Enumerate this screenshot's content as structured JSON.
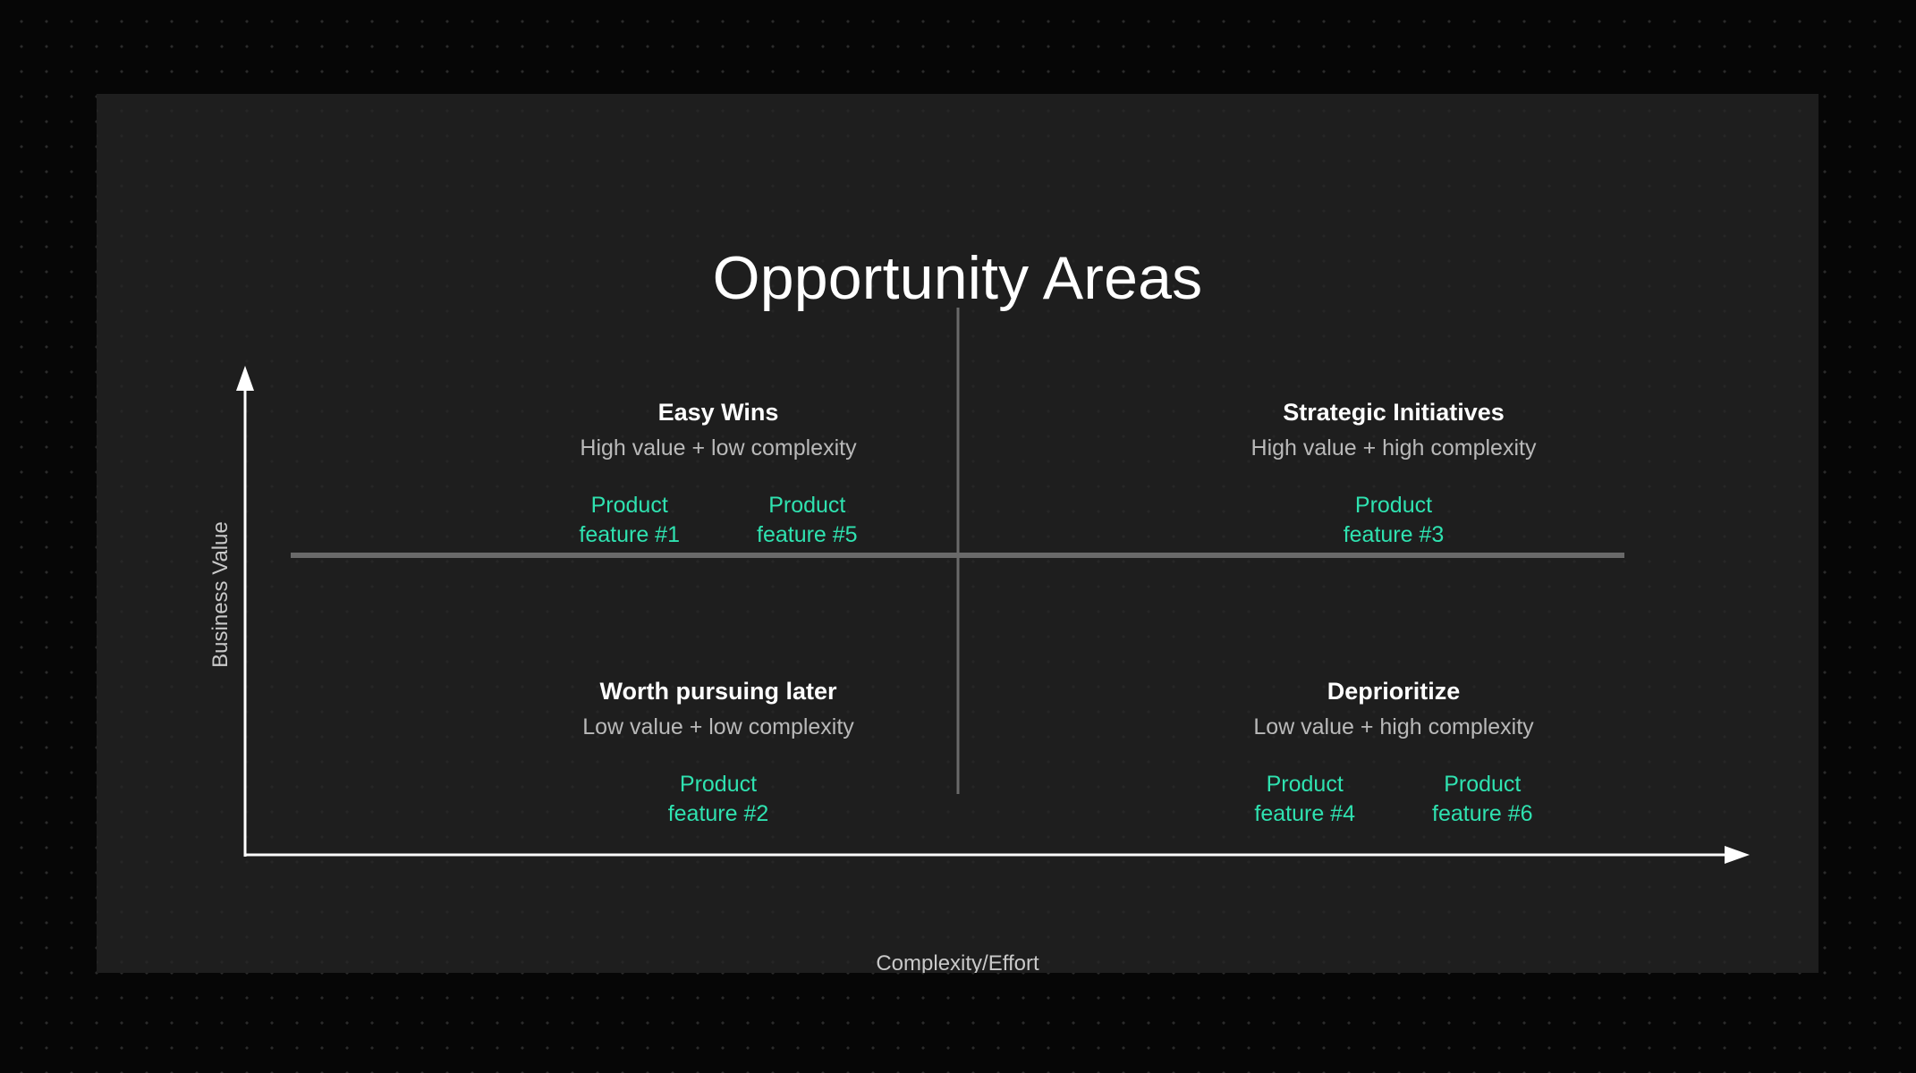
{
  "slide": {
    "title": "Opportunity Areas",
    "accent_color": "#2fe2b0",
    "card_background": "#1e1e1e",
    "page_background": "#060606"
  },
  "axes": {
    "y_label": "Business Value",
    "x_label": "Complexity/Effort",
    "axis_color": "#ffffff",
    "divider_color": "#6a6a6a"
  },
  "quadrants": [
    {
      "id": "easy-wins",
      "title": "Easy Wins",
      "subtitle": "High value + low complexity",
      "features": [
        "Product\nfeature #1",
        "Product\nfeature #5"
      ],
      "feature_line1": "Product",
      "items": [
        {
          "line1": "Product",
          "line2": "feature #1"
        },
        {
          "line1": "Product",
          "line2": "feature #5"
        }
      ]
    },
    {
      "id": "strategic-initiatives",
      "title": "Strategic Initiatives",
      "subtitle": "High value + high complexity",
      "items": [
        {
          "line1": "Product",
          "line2": "feature #3"
        }
      ]
    },
    {
      "id": "worth-pursuing-later",
      "title": "Worth pursuing later",
      "subtitle": "Low value + low complexity",
      "items": [
        {
          "line1": "Product",
          "line2": "feature #2"
        }
      ]
    },
    {
      "id": "deprioritize",
      "title": "Deprioritize",
      "subtitle": "Low value + high complexity",
      "items": [
        {
          "line1": "Product",
          "line2": "feature #4"
        },
        {
          "line1": "Product",
          "line2": "feature #6"
        }
      ]
    }
  ]
}
